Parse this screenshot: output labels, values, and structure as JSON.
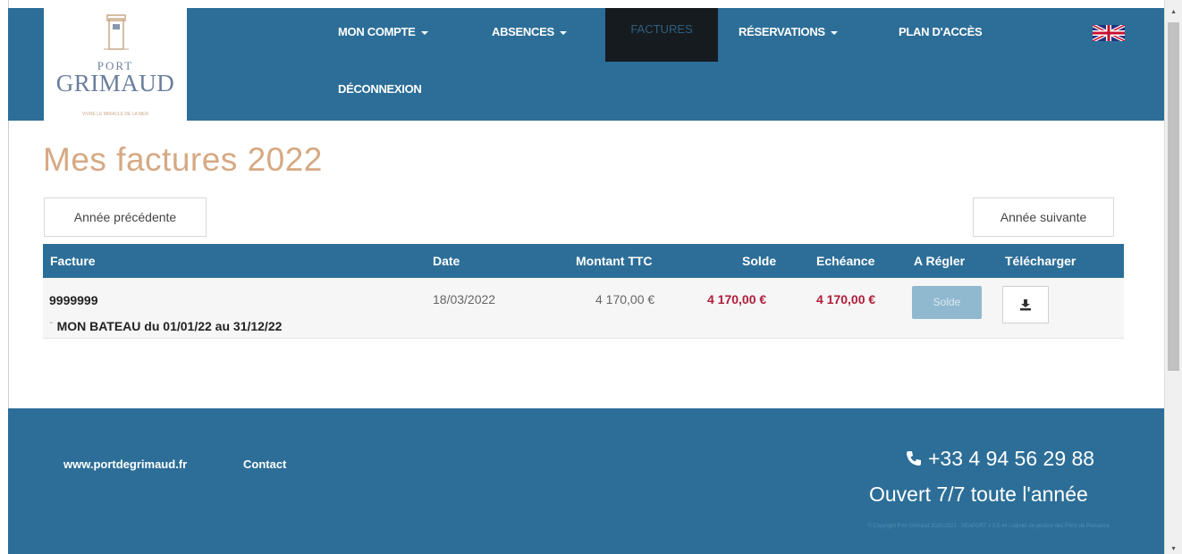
{
  "logo": {
    "port": "PORT",
    "name": "GRIMAUD",
    "tagline": "VIVRE LE MIRACLE DE LA MER"
  },
  "nav": {
    "mon_compte": "MON COMPTE",
    "absences": "ABSENCES",
    "factures": "FACTURES",
    "reservations": "RÉSERVATIONS",
    "plan_acces": "PLAN D'ACCÈS",
    "deconnexion": "DÉCONNEXION",
    "language_flag": "uk-flag-icon"
  },
  "page": {
    "title": "Mes factures 2022"
  },
  "buttons": {
    "previous_year": "Année précédente",
    "next_year": "Année suivante"
  },
  "table": {
    "headers": [
      "Facture",
      "Date",
      "Montant TTC",
      "Solde",
      "Echéance",
      "A Régler",
      "Télécharger"
    ],
    "rows": [
      {
        "invoice": "9999999",
        "description": "MON BATEAU du 01/01/22 au 31/12/22",
        "date": "18/03/2022",
        "amount": "4 170,00 €",
        "balance": "4 170,00 €",
        "due": "4 170,00 €",
        "pay_button": "Solde",
        "download_icon": "download-icon"
      }
    ]
  },
  "footer": {
    "website": "www.portdegrimaud.fr",
    "contact": "Contact",
    "phone": "+33 4 94 56 29 88",
    "opening": "Ouvert 7/7 toute l'année",
    "copyright": "© Copyright Port Grimaud 2020-2022 - SEAPORT v 3.5.44 Logiciel de gestion des Ports de Plaisance"
  },
  "colors": {
    "primary": "#2c6e98",
    "accent": "#d6a983",
    "danger": "#b01d3a",
    "nav_active": "#161b1f"
  }
}
